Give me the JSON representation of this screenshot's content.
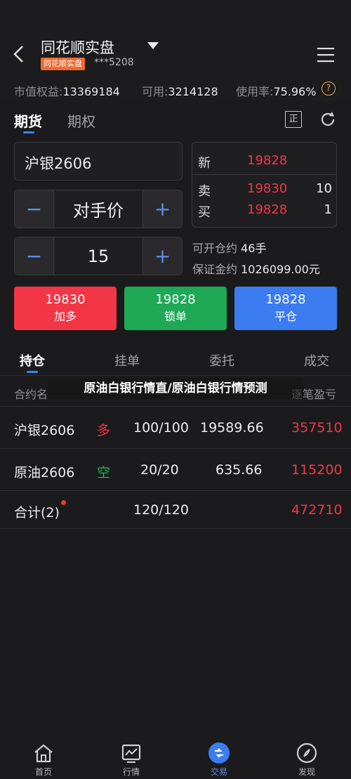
{
  "header": {
    "account_name": "同花顺实盘",
    "account_badge": "同花顺实盘",
    "account_number": "***5208"
  },
  "summary": {
    "equity_label": "市值权益:",
    "equity_value": "13369184",
    "available_label": "可用:",
    "available_value": "3214128",
    "usage_label": "使用率:",
    "usage_value": "75.96%"
  },
  "top_tabs": [
    {
      "label": "期货"
    },
    {
      "label": "期权"
    }
  ],
  "top_tabs_active": 0,
  "icons": {
    "box_icon": "正"
  },
  "order": {
    "contract": "沪银2606",
    "price_type": "对手价",
    "quantity": "15",
    "minus": "−",
    "plus": "+"
  },
  "quote": {
    "last_label": "新",
    "last_price": "19828",
    "ask_label": "卖",
    "ask_price": "19830",
    "ask_vol": "10",
    "bid_label": "买",
    "bid_price": "19828",
    "bid_vol": "1"
  },
  "info": {
    "openable_label": "可开仓约",
    "openable_value": "46手",
    "margin_label": "保证金约",
    "margin_value": "1026099.00元"
  },
  "buttons": [
    {
      "price": "19830",
      "action": "加多",
      "color": "#f23645"
    },
    {
      "price": "19828",
      "action": "锁单",
      "color": "#1fa855"
    },
    {
      "price": "19828",
      "action": "平仓",
      "color": "#3b7cf0"
    }
  ],
  "bottom_tabs": [
    {
      "label": "持仓"
    },
    {
      "label": "挂单"
    },
    {
      "label": "委托"
    },
    {
      "label": "成交"
    }
  ],
  "columns": {
    "contract": "合约名",
    "pnl": "逐笔盈亏"
  },
  "overlay_text": "原油白银行情直/原油白银行情预测",
  "positions": [
    {
      "contract": "沪银2606",
      "direction": "多",
      "lots": "100/100",
      "avg_price": "19589.66",
      "pnl": "357510"
    },
    {
      "contract": "原油2606",
      "direction": "空",
      "lots": "20/20",
      "avg_price": "635.66",
      "pnl": "115200"
    }
  ],
  "total": {
    "label": "合计(2)",
    "lots": "120/120",
    "pnl": "472710"
  },
  "nav": [
    {
      "label": "首页",
      "icon": "home-icon"
    },
    {
      "label": "行情",
      "icon": "chart-icon"
    },
    {
      "label": "交易",
      "icon": "trade-icon"
    },
    {
      "label": "发现",
      "icon": "compass-icon"
    }
  ],
  "colors": {
    "up": "#f23645",
    "down": "#1fb35a",
    "accent": "#3b82f6",
    "badge": "#f06a2e"
  }
}
